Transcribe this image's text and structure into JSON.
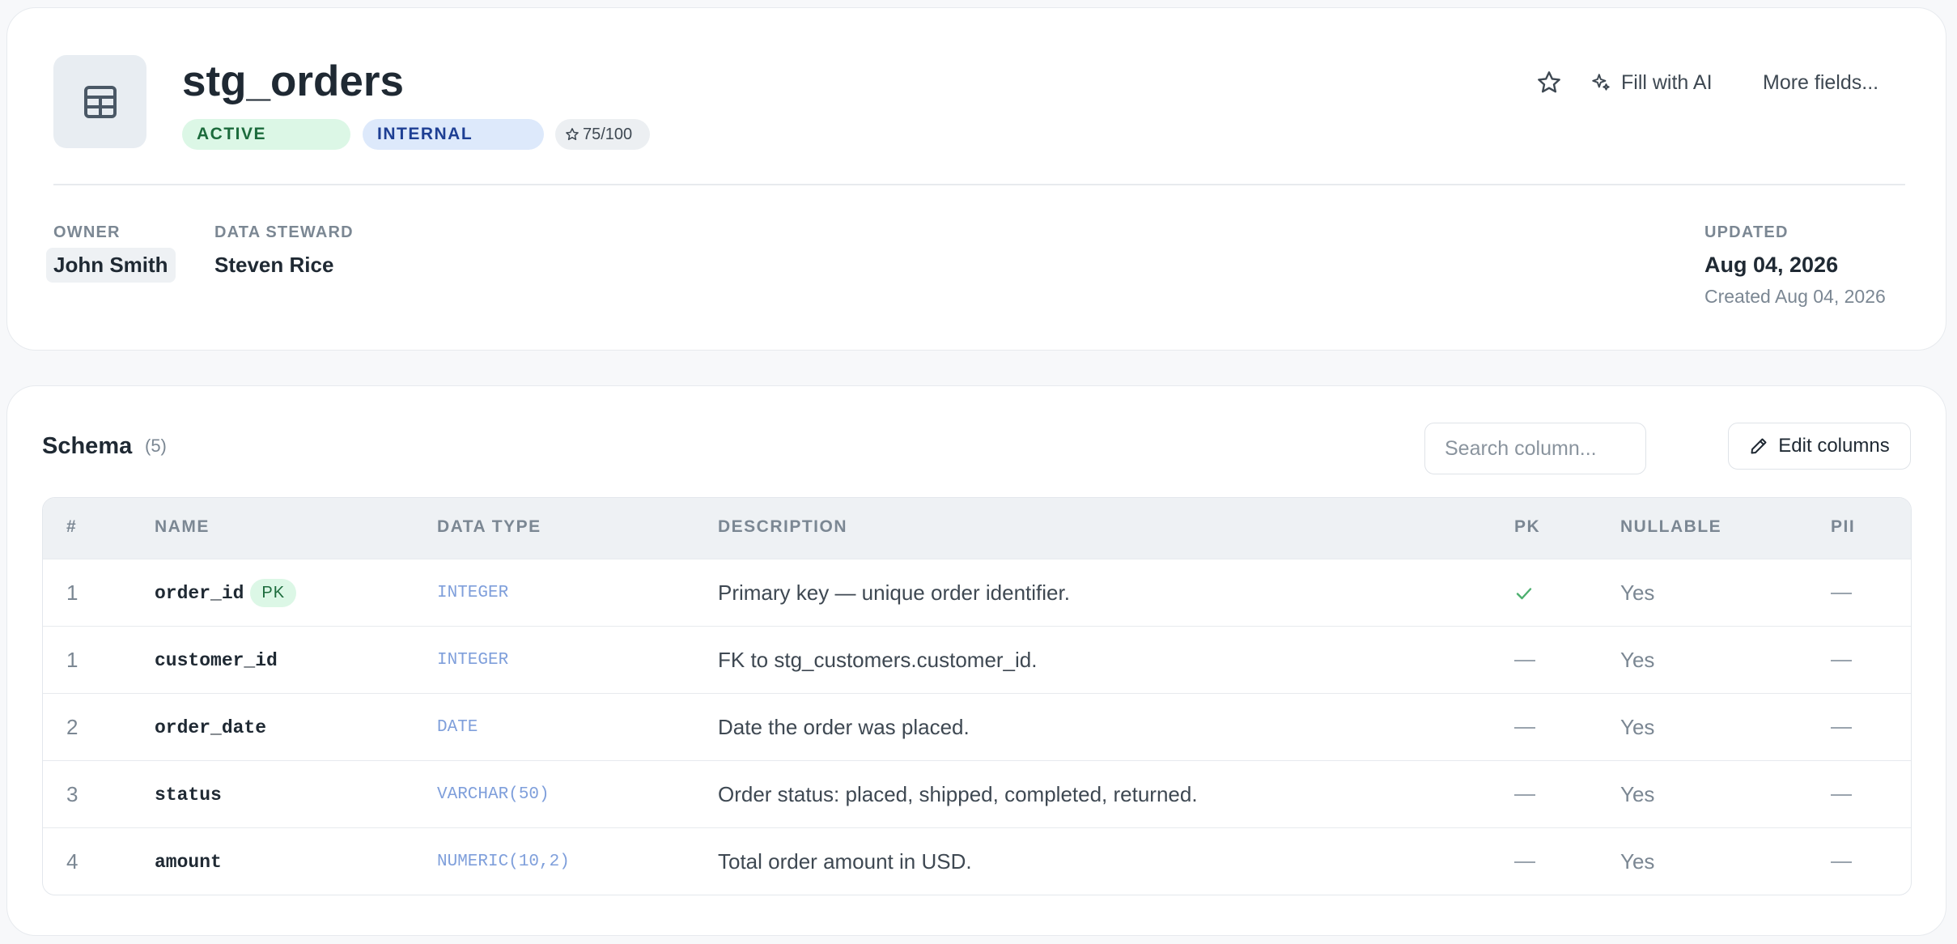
{
  "header": {
    "title": "stg_orders",
    "badges": {
      "status": "ACTIVE",
      "classification": "INTERNAL",
      "score": "75/100"
    },
    "actions": {
      "fill_ai": "Fill with AI",
      "more_fields": "More fields..."
    },
    "meta": {
      "owner_label": "OWNER",
      "owner": "John Smith",
      "steward_label": "DATA STEWARD",
      "steward": "Steven Rice",
      "updated_label": "UPDATED",
      "updated": "Aug 04, 2026",
      "created": "Created Aug 04, 2026"
    }
  },
  "schema": {
    "title": "Schema",
    "count": "(5)",
    "search_placeholder": "Search column...",
    "edit_label": "Edit columns",
    "columns": [
      "#",
      "NAME",
      "DATA TYPE",
      "DESCRIPTION",
      "PK",
      "NULLABLE",
      "PII"
    ],
    "rows": [
      {
        "num": "1",
        "name": "order_id",
        "pk_badge": "PK",
        "type": "INTEGER",
        "description": "Primary key — unique order identifier.",
        "pk": true,
        "nullable": "Yes",
        "pii": false
      },
      {
        "num": "1",
        "name": "customer_id",
        "pk_badge": "",
        "type": "INTEGER",
        "description": "FK to stg_customers.customer_id.",
        "pk": false,
        "nullable": "Yes",
        "pii": false
      },
      {
        "num": "2",
        "name": "order_date",
        "pk_badge": "",
        "type": "DATE",
        "description": "Date the order was placed.",
        "pk": false,
        "nullable": "Yes",
        "pii": false
      },
      {
        "num": "3",
        "name": "status",
        "pk_badge": "",
        "type": "VARCHAR(50)",
        "description": "Order status: placed, shipped, completed, returned.",
        "pk": false,
        "nullable": "Yes",
        "pii": false
      },
      {
        "num": "4",
        "name": "amount",
        "pk_badge": "",
        "type": "NUMERIC(10,2)",
        "description": "Total order amount in USD.",
        "pk": false,
        "nullable": "Yes",
        "pii": false
      }
    ]
  },
  "colors": {
    "accent_green": "#1c6b3c",
    "accent_blue": "#1e3f94",
    "type_blue": "#7f9fdb",
    "check_green": "#4caf6e"
  }
}
